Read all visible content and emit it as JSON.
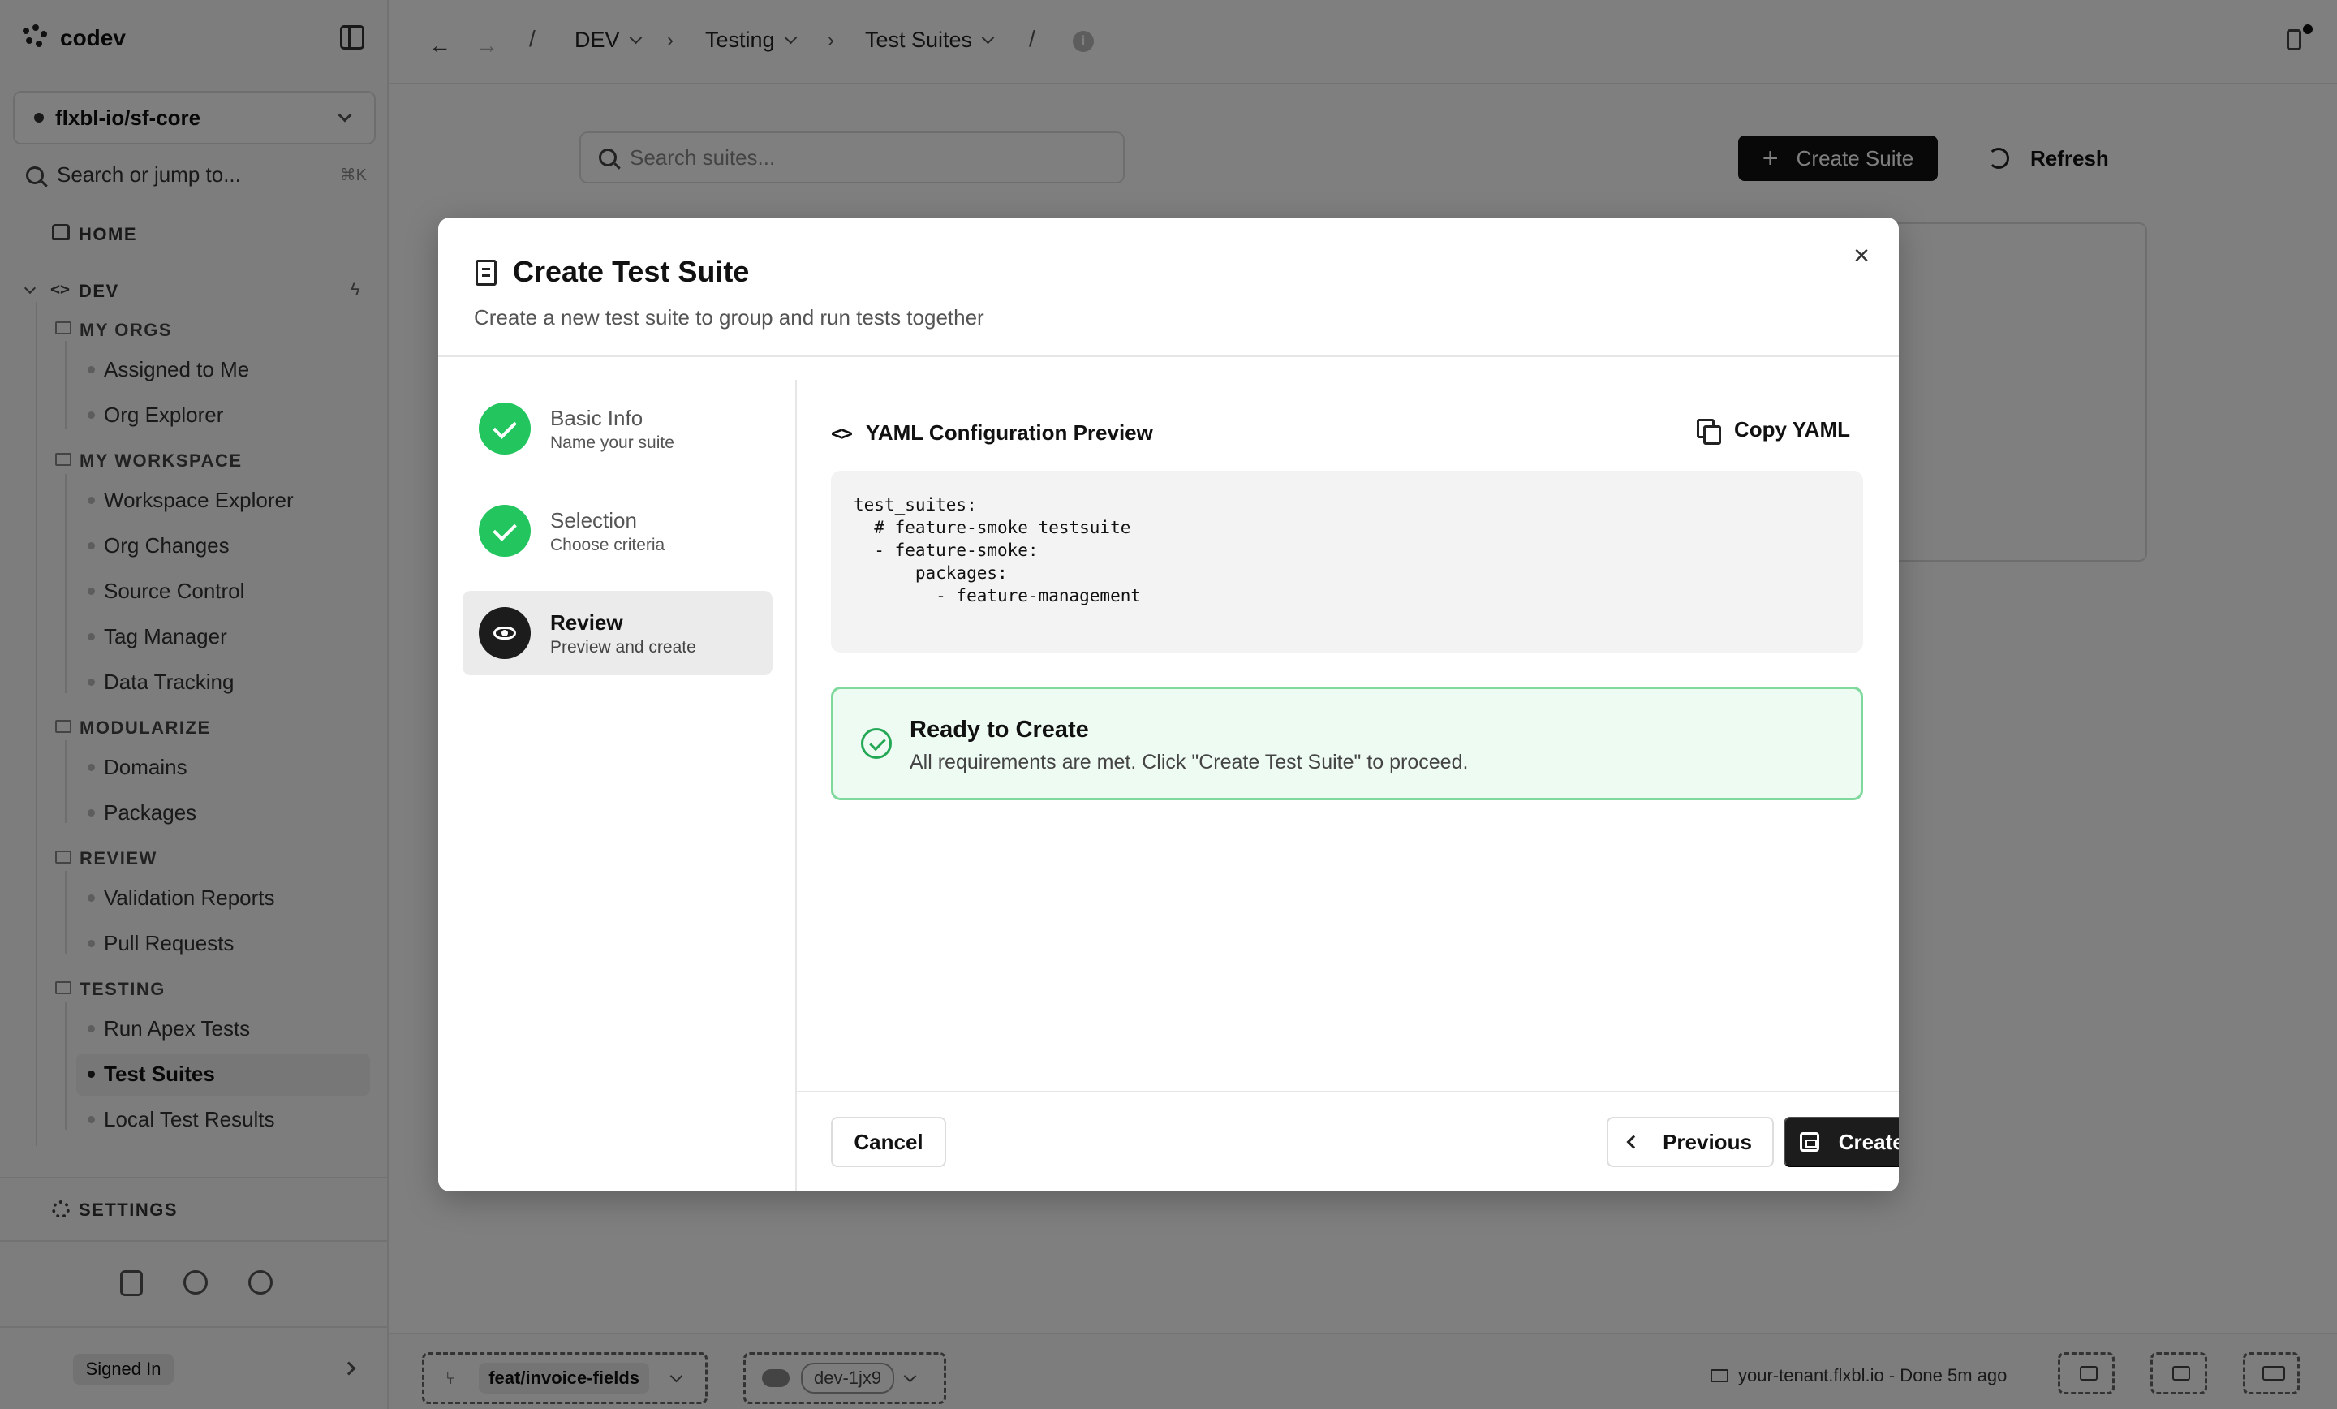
{
  "app": {
    "brand": "codev"
  },
  "sidebar": {
    "repo": "flxbl-io/sf-core",
    "jump_placeholder": "Search or jump to...",
    "jump_shortcut": "⌘K",
    "home": "HOME",
    "dev": "DEV",
    "sections": [
      {
        "title": "MY ORGS",
        "items": [
          "Assigned to Me",
          "Org Explorer"
        ]
      },
      {
        "title": "MY WORKSPACE",
        "items": [
          "Workspace Explorer",
          "Org Changes",
          "Source Control",
          "Tag Manager",
          "Data Tracking"
        ]
      },
      {
        "title": "MODULARIZE",
        "items": [
          "Domains",
          "Packages"
        ]
      },
      {
        "title": "REVIEW",
        "items": [
          "Validation Reports",
          "Pull Requests"
        ]
      },
      {
        "title": "TESTING",
        "items": [
          "Run Apex Tests",
          "Test Suites",
          "Local Test Results"
        ]
      }
    ],
    "active_item": "Test Suites",
    "settings": "SETTINGS",
    "signed_in": "Signed In"
  },
  "topbar": {
    "breadcrumbs": [
      "DEV",
      "Testing",
      "Test Suites"
    ],
    "separator": "/"
  },
  "main": {
    "search_placeholder": "Search suites...",
    "create_button": "Create Suite",
    "refresh_button": "Refresh"
  },
  "statusbar": {
    "branch": "feat/invoice-fields",
    "org": "dev-1jx9",
    "tenant": "your-tenant.flxbl.io - Done 5m ago"
  },
  "modal": {
    "title": "Create Test Suite",
    "subtitle": "Create a new test suite to group and run tests together",
    "close": "×",
    "steps": [
      {
        "title": "Basic Info",
        "subtitle": "Name your suite",
        "state": "complete"
      },
      {
        "title": "Selection",
        "subtitle": "Choose criteria",
        "state": "complete"
      },
      {
        "title": "Review",
        "subtitle": "Preview and create",
        "state": "active"
      }
    ],
    "yaml_heading": "YAML Configuration Preview",
    "copy_button": "Copy YAML",
    "yaml": "test_suites:\n  # feature-smoke testsuite\n  - feature-smoke:\n      packages:\n        - feature-management",
    "ready_title": "Ready to Create",
    "ready_message": "All requirements are met. Click \"Create Test Suite\" to proceed.",
    "cancel_button": "Cancel",
    "previous_button": "Previous",
    "create_button": "Create Test Suite"
  },
  "colors": {
    "success": "#22c55e",
    "success_bg": "#eefbf2",
    "primary": "#1c1c1c",
    "overlay": "rgba(0,0,0,0.5)"
  }
}
